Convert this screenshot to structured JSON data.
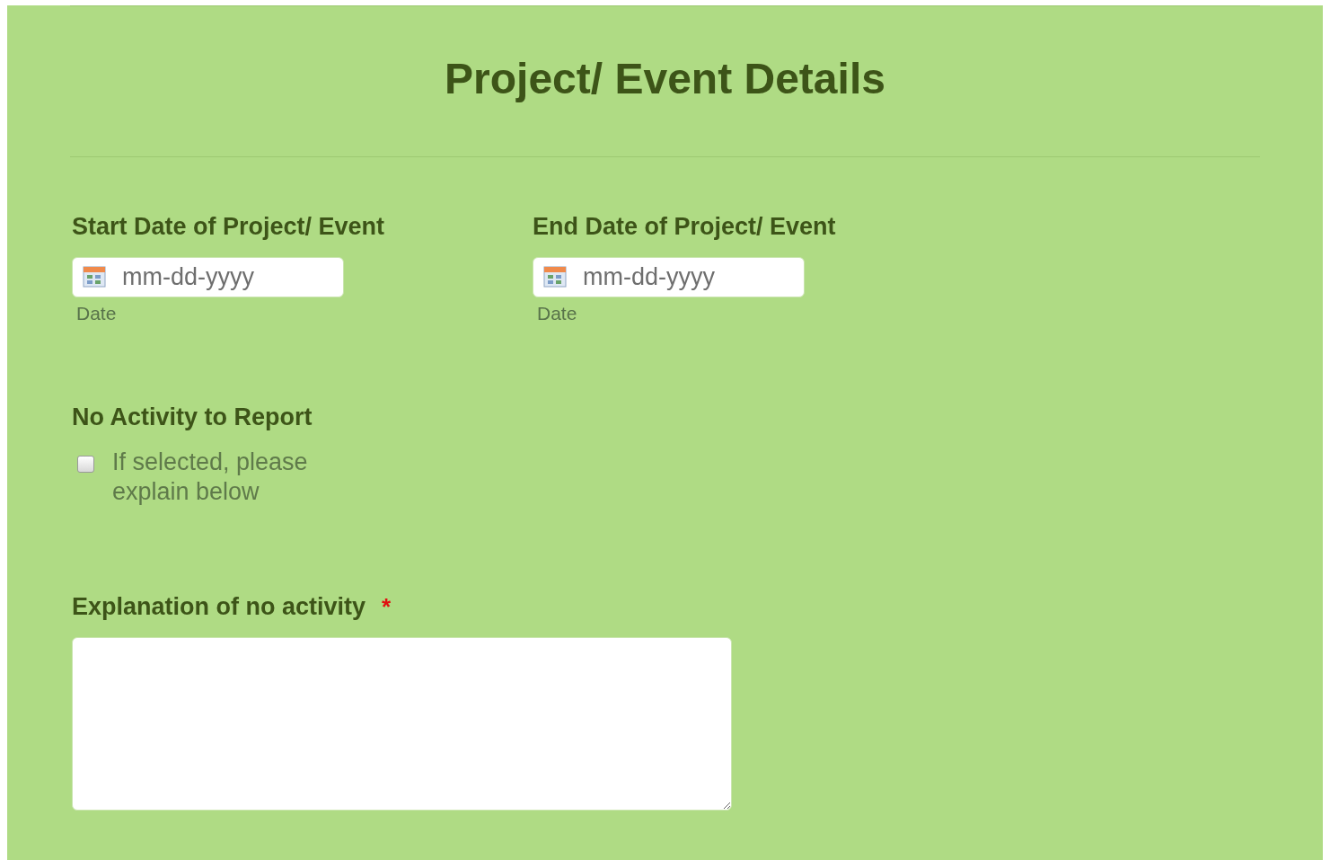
{
  "title": "Project/ Event Details",
  "date_fields": [
    {
      "label": "Start Date of Project/ Event",
      "placeholder": "mm-dd-yyyy",
      "sublabel": "Date"
    },
    {
      "label": "End Date of Project/ Event",
      "placeholder": "mm-dd-yyyy",
      "sublabel": "Date"
    }
  ],
  "no_activity": {
    "label": "No Activity to Report",
    "checked": false,
    "option": "If selected, please explain below"
  },
  "explanation": {
    "label": "Explanation of no activity",
    "required_mark": "*"
  }
}
